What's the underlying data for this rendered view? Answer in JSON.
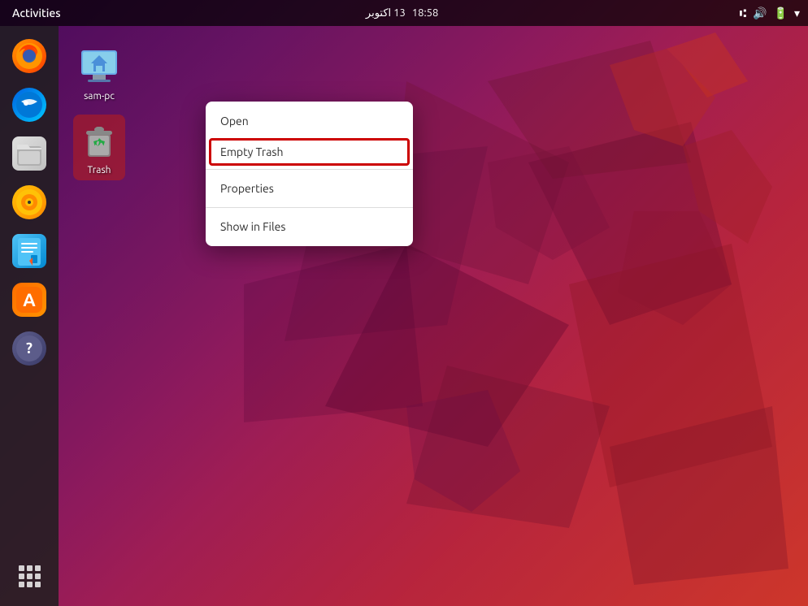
{
  "topbar": {
    "activities": "Activities",
    "time": "18:58",
    "date": "13 اکتوبر",
    "icons": [
      "network",
      "volume",
      "battery",
      "chevron"
    ]
  },
  "dock": {
    "items": [
      {
        "name": "firefox",
        "label": "Firefox",
        "icon": "🦊"
      },
      {
        "name": "thunderbird",
        "label": "Thunderbird",
        "icon": "🐦"
      },
      {
        "name": "files",
        "label": "Files",
        "icon": "📁"
      },
      {
        "name": "rhythmbox",
        "label": "Rhythmbox",
        "icon": "🎵"
      },
      {
        "name": "writer",
        "label": "Writer",
        "icon": "📝"
      },
      {
        "name": "appcenter",
        "label": "App Center",
        "icon": "🛍"
      },
      {
        "name": "help",
        "label": "Help",
        "icon": "?"
      }
    ],
    "grid_label": "Show Apps"
  },
  "desktop_icons": [
    {
      "name": "sam-pc",
      "label": "sam-pc",
      "selected": false
    },
    {
      "name": "trash",
      "label": "Trash",
      "selected": true
    }
  ],
  "context_menu": {
    "title": "Trash context menu",
    "items": [
      {
        "id": "open",
        "label": "Open",
        "highlighted": false
      },
      {
        "id": "empty-trash",
        "label": "Empty Trash",
        "highlighted": true
      },
      {
        "id": "separator1",
        "type": "separator"
      },
      {
        "id": "properties",
        "label": "Properties",
        "highlighted": false
      },
      {
        "id": "separator2",
        "type": "separator"
      },
      {
        "id": "show-in-files",
        "label": "Show in Files",
        "highlighted": false
      }
    ]
  }
}
